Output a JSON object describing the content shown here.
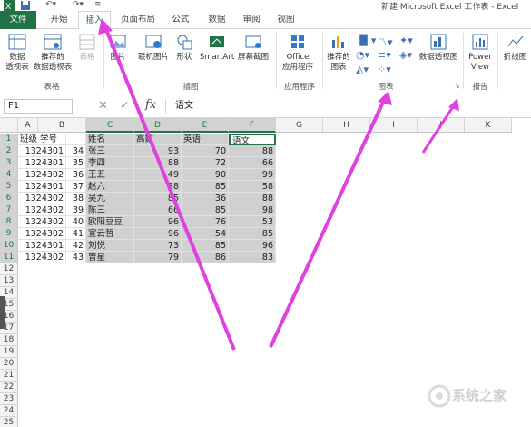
{
  "window": {
    "title": "新建 Microsoft Excel 工作表 - Excel"
  },
  "tabs": [
    {
      "label": "文件"
    },
    {
      "label": "开始"
    },
    {
      "label": "插入"
    },
    {
      "label": "页面布局"
    },
    {
      "label": "公式"
    },
    {
      "label": "数据"
    },
    {
      "label": "审阅"
    },
    {
      "label": "视图"
    }
  ],
  "ribbon": {
    "groups": {
      "tables": "表格",
      "illustrations": "插图",
      "apps": "应用程序",
      "charts": "图表",
      "reports": "报告"
    },
    "buttons": {
      "pivot_table": "数据\n透视表",
      "recommended_pivot": "推荐的\n数据透视表",
      "table": "表格",
      "pictures": "图片",
      "online_pictures": "联机图片",
      "shapes": "形状",
      "smartart": "SmartArt",
      "screenshot": "屏幕截图",
      "office_apps": "Office\n应用程序",
      "recommended_charts": "推荐的\n图表",
      "pivot_chart": "数据透视图",
      "power_view": "Power\nView",
      "sparkline": "折线图"
    }
  },
  "formula_bar": {
    "name_box": "F1",
    "content": "语文",
    "fx": "fx"
  },
  "columns": [
    "A",
    "B",
    "C",
    "D",
    "E",
    "F",
    "G",
    "H",
    "I",
    "J",
    "K"
  ],
  "rows": [
    "1",
    "2",
    "3",
    "4",
    "5",
    "6",
    "7",
    "8",
    "9",
    "10",
    "11",
    "12",
    "13",
    "14",
    "15",
    "16",
    "17",
    "18",
    "19",
    "20",
    "21",
    "22",
    "23",
    "24",
    "25"
  ],
  "table": {
    "headers": [
      "班级",
      "学号",
      "姓名",
      "高数",
      "英语",
      "语文"
    ],
    "data": [
      [
        "1324301",
        "34",
        "张三",
        "93",
        "70",
        "88"
      ],
      [
        "1324301",
        "35",
        "李四",
        "88",
        "72",
        "66"
      ],
      [
        "1324302",
        "36",
        "王五",
        "49",
        "90",
        "99"
      ],
      [
        "1324301",
        "37",
        "赵六",
        "88",
        "85",
        "58"
      ],
      [
        "1324302",
        "38",
        "吴九",
        "85",
        "36",
        "88"
      ],
      [
        "1324302",
        "39",
        "陈三",
        "66",
        "85",
        "98"
      ],
      [
        "1324302",
        "40",
        "欧阳豆豆",
        "96",
        "76",
        "53"
      ],
      [
        "1324302",
        "41",
        "宣云哲",
        "96",
        "54",
        "85"
      ],
      [
        "1324301",
        "42",
        "刘悦",
        "73",
        "85",
        "96"
      ],
      [
        "1324302",
        "43",
        "曾星",
        "79",
        "86",
        "83"
      ]
    ]
  },
  "colors": {
    "accent": "#217346",
    "arrow": "#e040e0",
    "selection": "#d0d0d0"
  }
}
